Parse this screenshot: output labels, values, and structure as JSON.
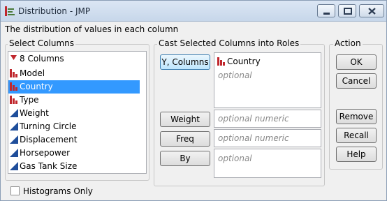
{
  "window": {
    "title": "Distribution - JMP"
  },
  "subtitle": "The distribution of values in each column",
  "select_columns": {
    "group_label": "Select Columns",
    "count_label": "8 Columns",
    "columns": [
      {
        "name": "Model",
        "type": "nominal",
        "selected": false
      },
      {
        "name": "Country",
        "type": "nominal",
        "selected": true
      },
      {
        "name": "Type",
        "type": "nominal",
        "selected": false
      },
      {
        "name": "Weight",
        "type": "continuous",
        "selected": false
      },
      {
        "name": "Turning Circle",
        "type": "continuous",
        "selected": false
      },
      {
        "name": "Displacement",
        "type": "continuous",
        "selected": false
      },
      {
        "name": "Horsepower",
        "type": "continuous",
        "selected": false
      },
      {
        "name": "Gas Tank Size",
        "type": "continuous",
        "selected": false
      }
    ]
  },
  "cast_roles": {
    "group_label": "Cast Selected Columns into Roles",
    "y_columns": {
      "button_label": "Y, Columns",
      "assigned": "Country",
      "placeholder": "optional"
    },
    "weight": {
      "button_label": "Weight",
      "placeholder": "optional numeric"
    },
    "freq": {
      "button_label": "Freq",
      "placeholder": "optional numeric"
    },
    "by": {
      "button_label": "By",
      "placeholder": "optional"
    }
  },
  "action": {
    "group_label": "Action",
    "ok_label": "OK",
    "cancel_label": "Cancel",
    "remove_label": "Remove",
    "recall_label": "Recall",
    "help_label": "Help"
  },
  "histograms_only": {
    "label": "Histograms Only",
    "checked": false
  },
  "colors": {
    "nominal_icon": "#c0272d",
    "continuous_icon": "#1f4e9b",
    "selection": "#3399ff"
  }
}
